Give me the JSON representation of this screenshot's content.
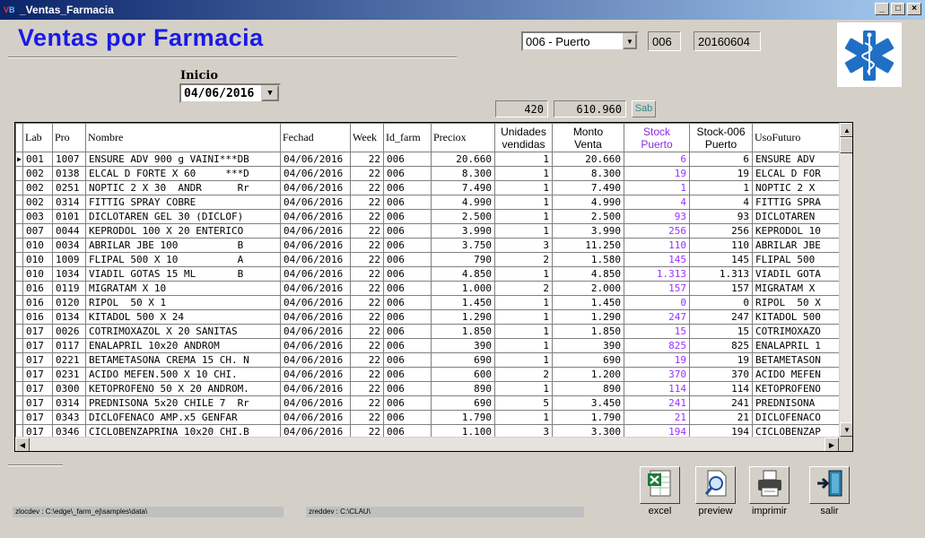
{
  "window": {
    "title": "_Ventas_Farmacia",
    "icon_text": [
      "V",
      "B"
    ],
    "controls": [
      "_",
      "□",
      "×"
    ]
  },
  "header": {
    "title": "Ventas por Farmacia",
    "pharmacy_select": "006 - Puerto",
    "pharmacy_code": "006",
    "date_code": "20160604"
  },
  "inicio": {
    "label": "Inicio",
    "date": "04/06/2016"
  },
  "totals": {
    "units": "420",
    "amount": "610.960",
    "day": "Sab"
  },
  "columns": [
    {
      "label": "Lab",
      "two_line": false
    },
    {
      "label": "Pro",
      "two_line": false
    },
    {
      "label": "Nombre",
      "two_line": false
    },
    {
      "label": "Fechad",
      "two_line": false
    },
    {
      "label": "Week",
      "two_line": false
    },
    {
      "label": "Id_farm",
      "two_line": false
    },
    {
      "label": "Preciox",
      "two_line": false
    },
    {
      "label": "Unidades\nvendidas",
      "two_line": true
    },
    {
      "label": "Monto\nVenta",
      "two_line": true
    },
    {
      "label": "Stock\nPuerto",
      "two_line": true,
      "color": "violet"
    },
    {
      "label": "Stock-006\nPuerto",
      "two_line": true
    },
    {
      "label": "UsoFuturo",
      "two_line": false
    }
  ],
  "rows": [
    [
      "001",
      "1007",
      "ENSURE ADV 900 g VAINI***DB",
      "04/06/2016",
      "22",
      "006",
      "20.660",
      "1",
      "20.660",
      "6",
      "6",
      "ENSURE ADV"
    ],
    [
      "002",
      "0138",
      "ELCAL D FORTE X 60     ***D",
      "04/06/2016",
      "22",
      "006",
      "8.300",
      "1",
      "8.300",
      "19",
      "19",
      "ELCAL D FOR"
    ],
    [
      "002",
      "0251",
      "NOPTIC 2 X 30  ANDR      Rr",
      "04/06/2016",
      "22",
      "006",
      "7.490",
      "1",
      "7.490",
      "1",
      "1",
      "NOPTIC 2 X"
    ],
    [
      "002",
      "0314",
      "FITTIG SPRAY COBRE",
      "04/06/2016",
      "22",
      "006",
      "4.990",
      "1",
      "4.990",
      "4",
      "4",
      "FITTIG SPRA"
    ],
    [
      "003",
      "0101",
      "DICLOTAREN GEL 30 (DICLOF)",
      "04/06/2016",
      "22",
      "006",
      "2.500",
      "1",
      "2.500",
      "93",
      "93",
      "DICLOTAREN"
    ],
    [
      "007",
      "0044",
      "KEPRODOL 100 X 20 ENTERICO",
      "04/06/2016",
      "22",
      "006",
      "3.990",
      "1",
      "3.990",
      "256",
      "256",
      "KEPRODOL 10"
    ],
    [
      "010",
      "0034",
      "ABRILAR JBE 100          B",
      "04/06/2016",
      "22",
      "006",
      "3.750",
      "3",
      "11.250",
      "110",
      "110",
      "ABRILAR JBE"
    ],
    [
      "010",
      "1009",
      "FLIPAL 500 X 10          A",
      "04/06/2016",
      "22",
      "006",
      "790",
      "2",
      "1.580",
      "145",
      "145",
      "FLIPAL 500"
    ],
    [
      "010",
      "1034",
      "VIADIL GOTAS 15 ML       B",
      "04/06/2016",
      "22",
      "006",
      "4.850",
      "1",
      "4.850",
      "1.313",
      "1.313",
      "VIADIL GOTA"
    ],
    [
      "016",
      "0119",
      "MIGRATAM X 10",
      "04/06/2016",
      "22",
      "006",
      "1.000",
      "2",
      "2.000",
      "157",
      "157",
      "MIGRATAM X"
    ],
    [
      "016",
      "0120",
      "RIPOL  50 X 1",
      "04/06/2016",
      "22",
      "006",
      "1.450",
      "1",
      "1.450",
      "0",
      "0",
      "RIPOL  50 X"
    ],
    [
      "016",
      "0134",
      "KITADOL 500 X 24",
      "04/06/2016",
      "22",
      "006",
      "1.290",
      "1",
      "1.290",
      "247",
      "247",
      "KITADOL 500"
    ],
    [
      "017",
      "0026",
      "COTRIMOXAZOL X 20 SANITAS",
      "04/06/2016",
      "22",
      "006",
      "1.850",
      "1",
      "1.850",
      "15",
      "15",
      "COTRIMOXAZO"
    ],
    [
      "017",
      "0117",
      "ENALAPRIL 10x20 ANDROM",
      "04/06/2016",
      "22",
      "006",
      "390",
      "1",
      "390",
      "825",
      "825",
      "ENALAPRIL 1"
    ],
    [
      "017",
      "0221",
      "BETAMETASONA CREMA 15 CH. N",
      "04/06/2016",
      "22",
      "006",
      "690",
      "1",
      "690",
      "19",
      "19",
      "BETAMETASON"
    ],
    [
      "017",
      "0231",
      "ACIDO MEFEN.500 X 10 CHI.",
      "04/06/2016",
      "22",
      "006",
      "600",
      "2",
      "1.200",
      "370",
      "370",
      "ACIDO MEFEN"
    ],
    [
      "017",
      "0300",
      "KETOPROFENO 50 X 20 ANDROM.",
      "04/06/2016",
      "22",
      "006",
      "890",
      "1",
      "890",
      "114",
      "114",
      "KETOPROFENO"
    ],
    [
      "017",
      "0314",
      "PREDNISONA 5x20 CHILE 7  Rr",
      "04/06/2016",
      "22",
      "006",
      "690",
      "5",
      "3.450",
      "241",
      "241",
      "PREDNISONA"
    ],
    [
      "017",
      "0343",
      "DICLOFENACO AMP.x5 GENFAR",
      "04/06/2016",
      "22",
      "006",
      "1.790",
      "1",
      "1.790",
      "21",
      "21",
      "DICLOFENACO"
    ],
    [
      "017",
      "0346",
      "CICLOBENZAPRINA 10x20 CHI.B",
      "04/06/2016",
      "22",
      "006",
      "1.100",
      "3",
      "3.300",
      "194",
      "194",
      "CICLOBENZAP"
    ]
  ],
  "scroll": {
    "up": "▲",
    "down": "▼",
    "left": "◀",
    "right": "▶",
    "row_indicator": "▶"
  },
  "status": {
    "left": "zlocdev : C:\\edge\\_farm_ej\\samples\\data\\",
    "right": "zreddev : C:\\CLAU\\"
  },
  "actions": {
    "excel": "excel",
    "preview": "preview",
    "imprimir": "imprimir",
    "salir": "salir"
  },
  "colors": {
    "title_blue": "#1a1ae6",
    "stock_violet": "#9b30ff",
    "sab_teal": "#2e8b87"
  },
  "icons": [
    "excel-icon",
    "preview-icon",
    "printer-icon",
    "exit-door-icon",
    "caduceus-star-of-life-icon"
  ]
}
